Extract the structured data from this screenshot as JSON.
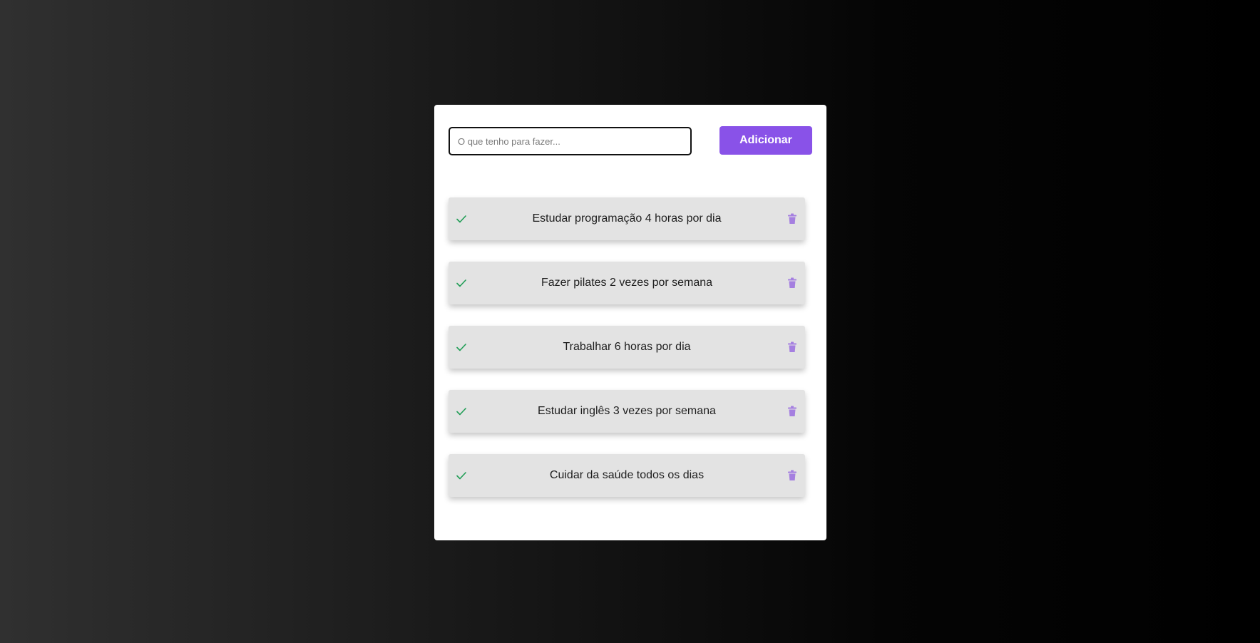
{
  "form": {
    "input_placeholder": "O que tenho para fazer...",
    "input_value": "",
    "add_label": "Adicionar"
  },
  "tasks": [
    {
      "text": "Estudar programação 4 horas por dia"
    },
    {
      "text": "Fazer pilates 2 vezes por semana"
    },
    {
      "text": "Trabalhar 6 horas por dia"
    },
    {
      "text": "Estudar inglês 3 vezes por semana"
    },
    {
      "text": "Cuidar da saúde todos os dias"
    }
  ],
  "icons": {
    "check": "check-icon",
    "trash": "trash-icon"
  },
  "colors": {
    "accent": "#8952e8",
    "check": "#1f9d55",
    "trash": "#a57fe0",
    "task_bg": "#e3e3e3",
    "card_bg": "#ffffff"
  }
}
